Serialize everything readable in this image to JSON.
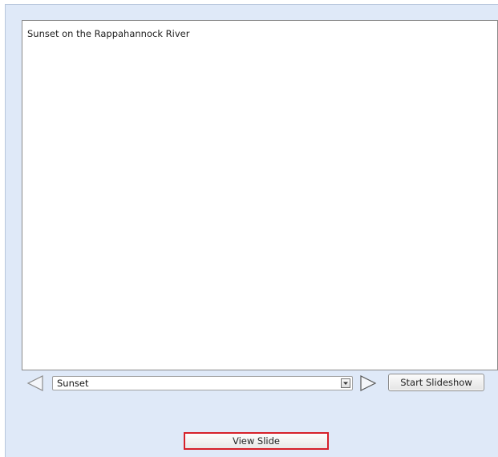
{
  "slide": {
    "caption": "Sunset on the Rappahannock River"
  },
  "navigation": {
    "prev_icon": "triangle-left-icon",
    "next_icon": "triangle-right-icon",
    "selected_slide": "Sunset",
    "dropdown_icon": "chevron-down-icon",
    "start_slideshow_label": "Start Slideshow"
  },
  "actions": {
    "view_slide_label": "View Slide"
  },
  "colors": {
    "background": "#dfe9f8",
    "highlight_border": "#d6202a"
  }
}
